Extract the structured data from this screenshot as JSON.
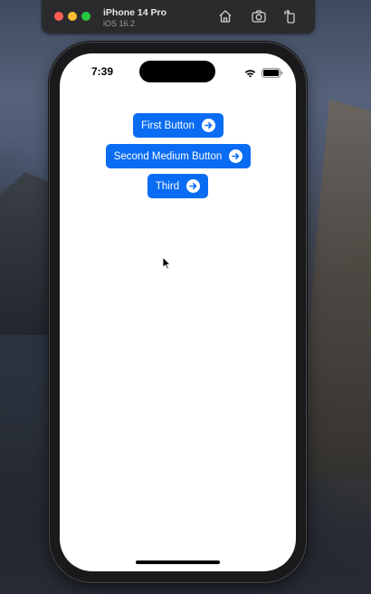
{
  "toolbar": {
    "device_name": "iPhone 14 Pro",
    "os_version": "iOS 16.2",
    "icons": [
      "home-icon",
      "screenshot-icon",
      "rotate-icon"
    ]
  },
  "status_bar": {
    "time": "7:39",
    "icons": [
      "wifi-icon",
      "battery-icon"
    ]
  },
  "buttons": [
    {
      "label": "First Button",
      "icon": "arrow-right-circle-icon"
    },
    {
      "label": "Second Medium Button",
      "icon": "arrow-right-circle-icon"
    },
    {
      "label": "Third",
      "icon": "arrow-right-circle-icon"
    }
  ],
  "colors": {
    "button_background": "#0a6cf3",
    "button_text": "#ffffff",
    "screen_background": "#ffffff",
    "toolbar_background": "#2b2b2d"
  }
}
